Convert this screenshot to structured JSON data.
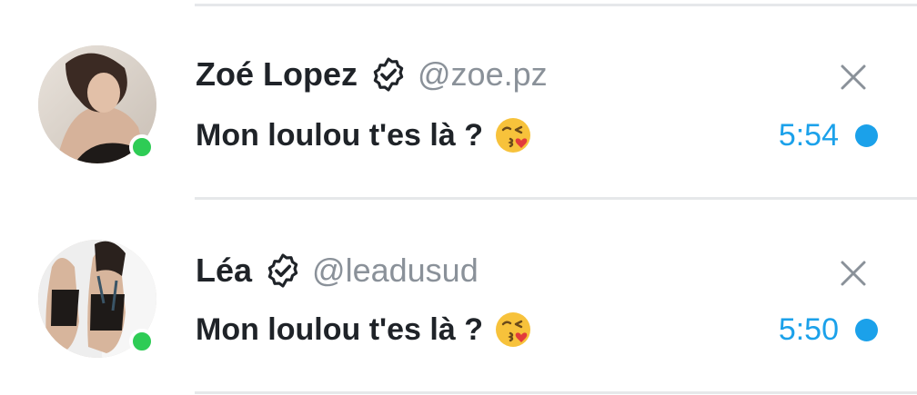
{
  "conversations": [
    {
      "name": "Zoé Lopez",
      "handle": "@zoe.pz",
      "message": "Mon loulou t'es là ?",
      "time": "5:54",
      "verified": true,
      "online": true,
      "unread": true,
      "emoji": "kissing-face-with-heart-emoji"
    },
    {
      "name": "Léa",
      "handle": "@leadusud",
      "message": "Mon loulou t'es là ?",
      "time": "5:50",
      "verified": true,
      "online": true,
      "unread": true,
      "emoji": "kissing-face-with-heart-emoji"
    }
  ],
  "colors": {
    "accent": "#1ba1ea",
    "online": "#2ecc55",
    "text": "#1f2328",
    "muted": "#8a9199",
    "divider": "#e6e8ea"
  }
}
